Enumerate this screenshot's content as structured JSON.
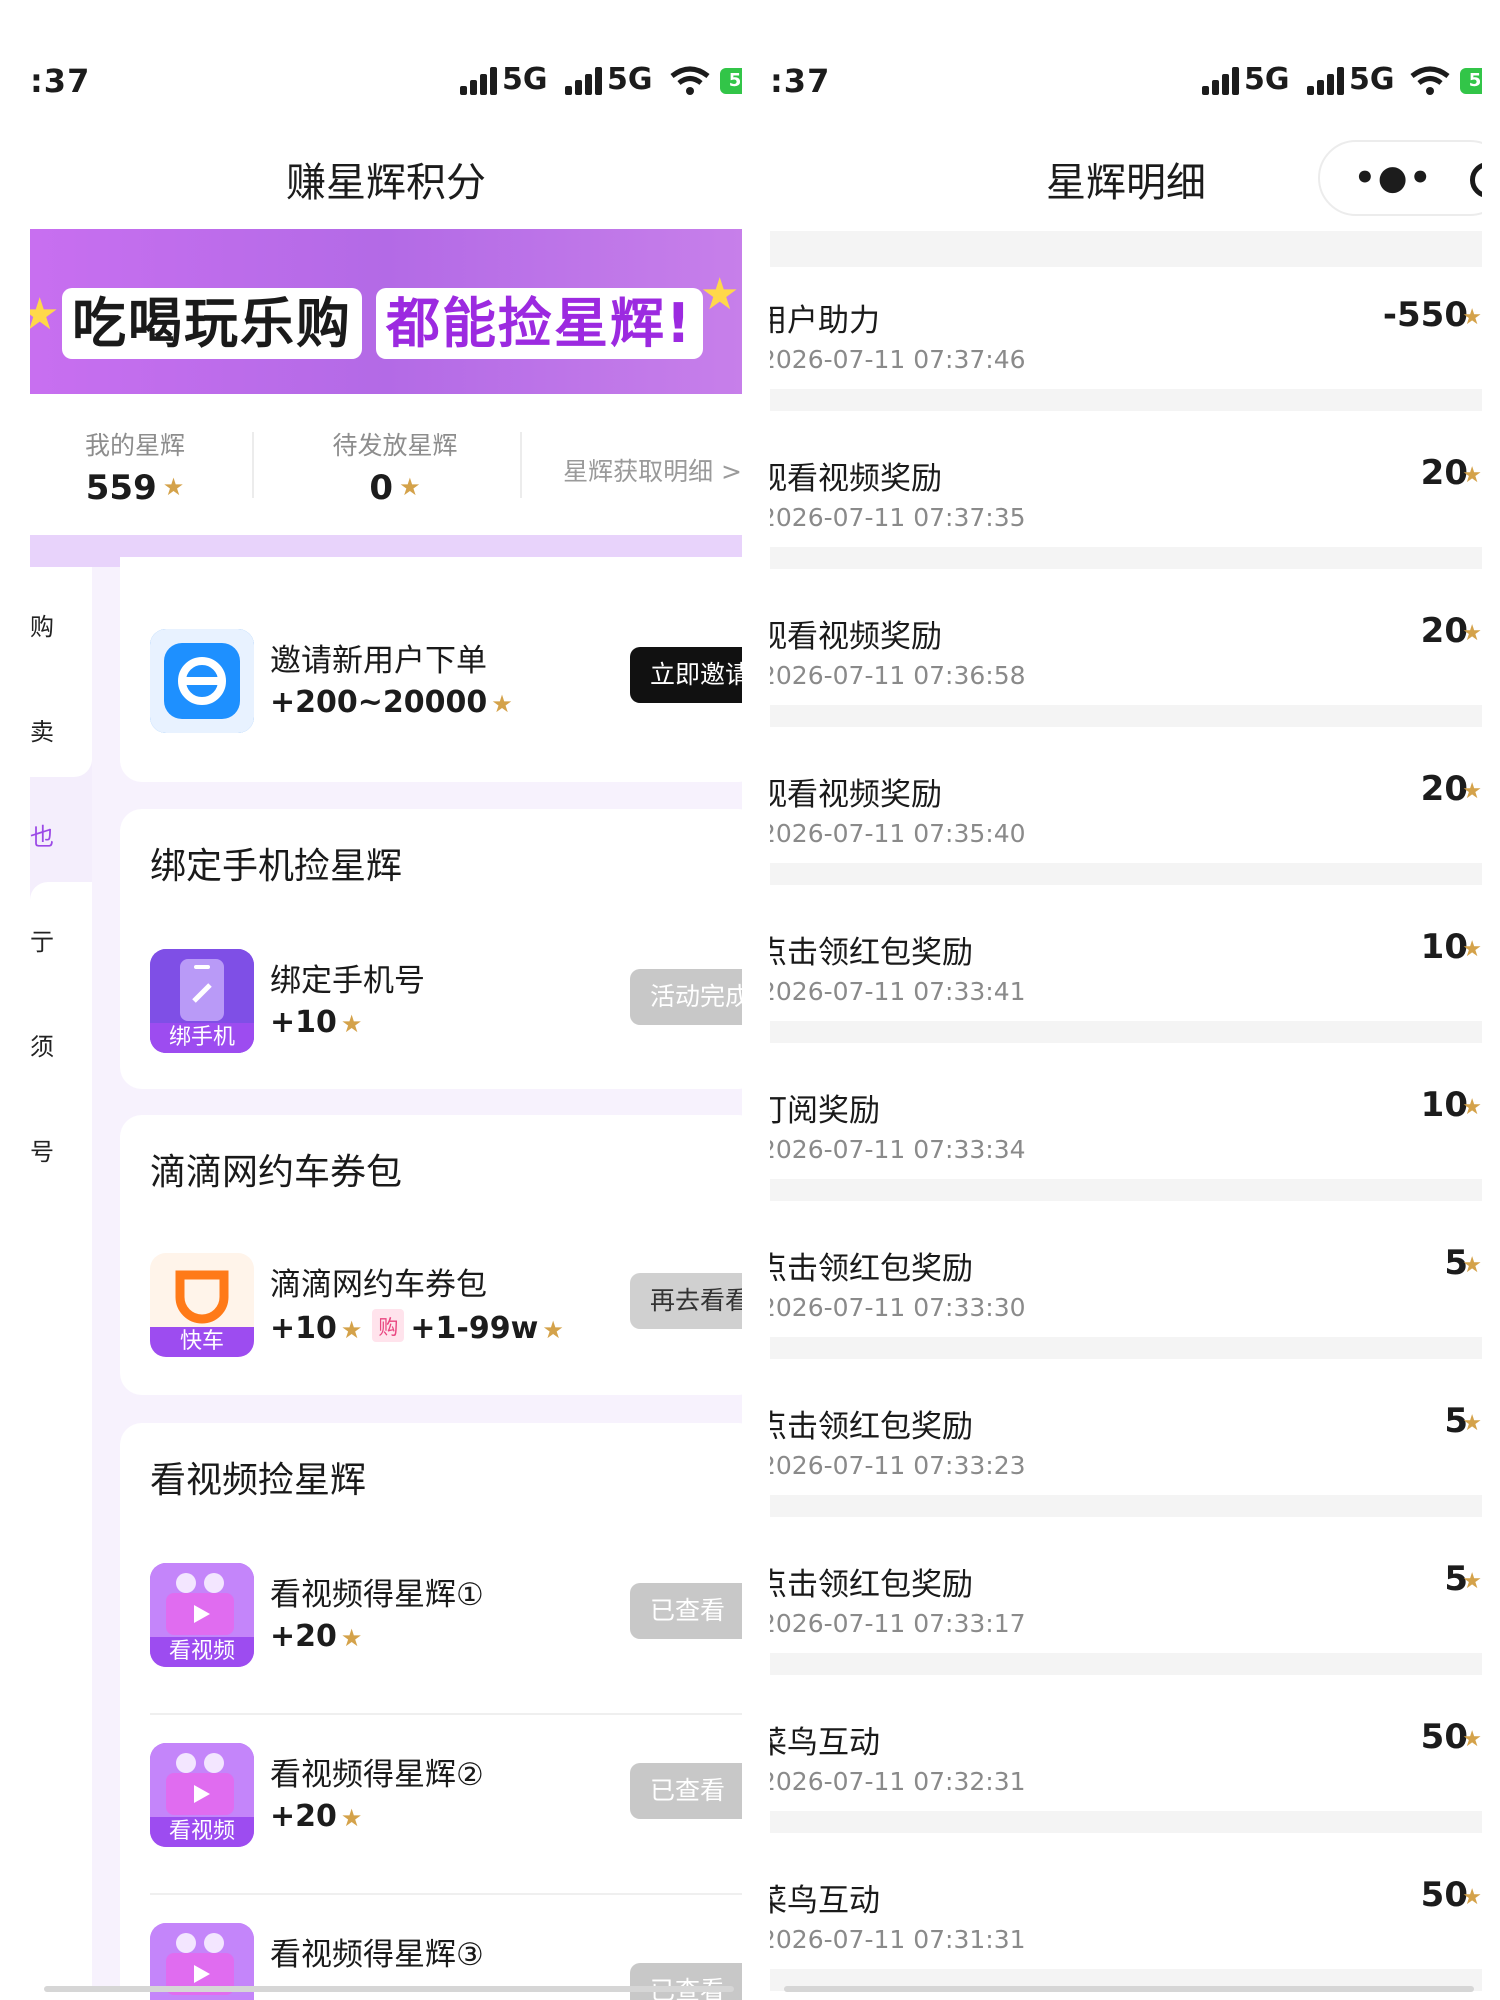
{
  "left": {
    "status": {
      "time": ":37",
      "net1": "5G",
      "net2": "5G",
      "battery": "5"
    },
    "title": "赚星辉积分",
    "banner": {
      "part1": "吃喝玩乐购",
      "part2": "都能捡星辉!"
    },
    "stats": {
      "my_label": "我的星辉",
      "my_value": "559",
      "pending_label": "待发放星辉",
      "pending_value": "0",
      "detail_link": "星辉获取明细 >"
    },
    "sidenav": [
      "购",
      "卖",
      "也",
      "亍",
      "须",
      "号"
    ],
    "card_invite": {
      "name": "邀请新用户下单",
      "reward": "+200~20000",
      "button": "立即邀请"
    },
    "card_bind": {
      "title": "绑定手机捡星辉",
      "task_name": "绑定手机号",
      "reward": "+10",
      "icon_label": "绑手机",
      "button": "活动完成"
    },
    "card_didi": {
      "title": "滴滴网约车券包",
      "task_name": "滴滴网约车券包",
      "reward": "+10",
      "tag": "购",
      "reward2": "+1-99w",
      "icon_label": "快车",
      "button": "再去看看"
    },
    "card_video": {
      "title": "看视频捡星辉",
      "tasks": [
        {
          "name": "看视频得星辉①",
          "reward": "+20",
          "icon_label": "看视频",
          "button": "已查看"
        },
        {
          "name": "看视频得星辉②",
          "reward": "+20",
          "icon_label": "看视频",
          "button": "已查看"
        },
        {
          "name": "看视频得星辉③",
          "reward": "",
          "icon_label": "",
          "button": "已查看"
        }
      ]
    }
  },
  "right": {
    "status": {
      "time": ":37",
      "net1": "5G",
      "net2": "5G",
      "battery": "5"
    },
    "title": "星辉明细",
    "more_dots": "•●•",
    "records": [
      {
        "name": "用户助力",
        "time": "2026-07-11 07:37:46",
        "value": "-550"
      },
      {
        "name": "观看视频奖励",
        "time": "2026-07-11 07:37:35",
        "value": "20"
      },
      {
        "name": "观看视频奖励",
        "time": "2026-07-11 07:36:58",
        "value": "20"
      },
      {
        "name": "观看视频奖励",
        "time": "2026-07-11 07:35:40",
        "value": "20"
      },
      {
        "name": "点击领红包奖励",
        "time": "2026-07-11 07:33:41",
        "value": "10"
      },
      {
        "name": "订阅奖励",
        "time": "2026-07-11 07:33:34",
        "value": "10"
      },
      {
        "name": "点击领红包奖励",
        "time": "2026-07-11 07:33:30",
        "value": "5"
      },
      {
        "name": "点击领红包奖励",
        "time": "2026-07-11 07:33:23",
        "value": "5"
      },
      {
        "name": "点击领红包奖励",
        "time": "2026-07-11 07:33:17",
        "value": "5"
      },
      {
        "name": "菜鸟互动",
        "time": "2026-07-11 07:32:31",
        "value": "50"
      },
      {
        "name": "菜鸟互动",
        "time": "2026-07-11 07:31:31",
        "value": "50"
      }
    ]
  },
  "colors": {
    "accent": "#9d4cf0",
    "star": "#d4a24a",
    "banner": "#c86ff0"
  }
}
